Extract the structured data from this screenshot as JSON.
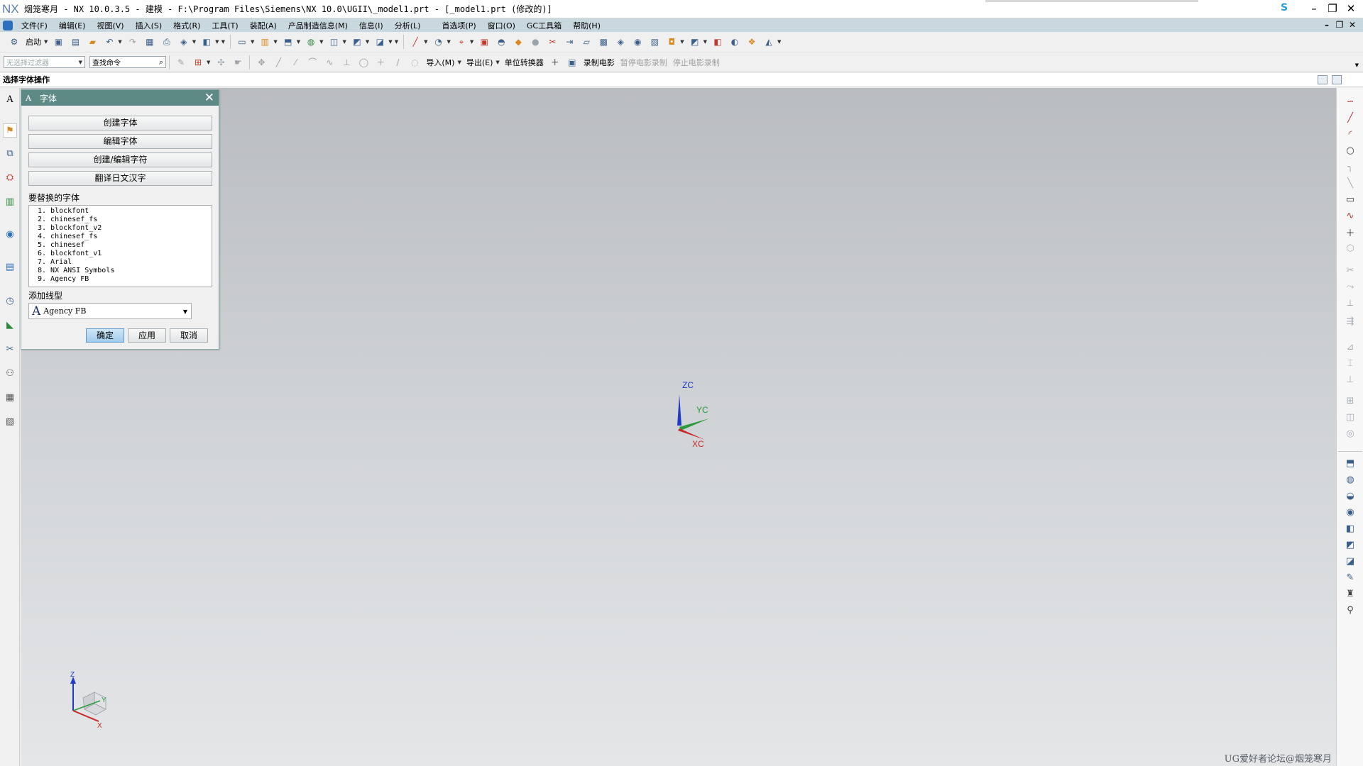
{
  "titlebar": {
    "logo": "NX",
    "title": "烟笼寒月 - NX 10.0.3.5 - 建模 - F:\\Program Files\\Siemens\\NX 10.0\\UGII\\_model1.prt - [_model1.prt (修改的)]",
    "s_icon": "S",
    "minimize": "–",
    "restore": "❐",
    "close": "✕"
  },
  "menubar": {
    "items": [
      "文件(F)",
      "编辑(E)",
      "视图(V)",
      "插入(S)",
      "格式(R)",
      "工具(T)",
      "装配(A)",
      "产品制造信息(M)",
      "信息(I)",
      "分析(L)",
      "首选项(P)",
      "窗口(O)",
      "GC工具箱",
      "帮助(H)"
    ],
    "mdi_minimize": "–",
    "mdi_restore": "❐",
    "mdi_close": "✕"
  },
  "toolbar1": {
    "start_label": "启动",
    "start_icon": "start-icon"
  },
  "toolbar2": {
    "filter_placeholder": "无选择过滤器",
    "search_placeholder": "查找命令",
    "import_label": "导入(M)",
    "export_label": "导出(E)",
    "unit_converter_label": "单位转换器",
    "record_movie_label": "录制电影",
    "pause_movie_label": "暂停电影录制",
    "stop_movie_label": "停止电影录制"
  },
  "cueline": {
    "text": "选择字体操作"
  },
  "leftbar": {
    "top_label": "A"
  },
  "dialog": {
    "title": "字体",
    "title_icon": "A",
    "close": "✕",
    "buttons": {
      "create_font": "创建字体",
      "edit_font": "编辑字体",
      "create_edit_char": "创建/编辑字符",
      "translate_kanji": "翻译日文汉字"
    },
    "replace_label": "要替换的字体",
    "fonts": [
      "1.  blockfont",
      "2.  chinesef_fs",
      "3.  blockfont_v2",
      "4.  chinesef_fs",
      "5.  chinesef",
      "6.  blockfont_v1",
      "7.  Arial",
      "8.  NX ANSI Symbols",
      "9.  Agency FB"
    ],
    "add_linetype_label": "添加线型",
    "selected_font": "Agency FB",
    "ok": "确定",
    "apply": "应用",
    "cancel": "取消"
  },
  "graphics": {
    "triad": {
      "zc": "ZC",
      "yc": "YC",
      "xc": "XC"
    },
    "view_triad": {
      "z": "Z",
      "y": "Y",
      "x": "X"
    },
    "colors": {
      "z": "#1f3cc8",
      "y": "#2a9a3a",
      "x": "#c82828"
    },
    "watermark": "UG爱好者论坛@烟笼寒月"
  }
}
